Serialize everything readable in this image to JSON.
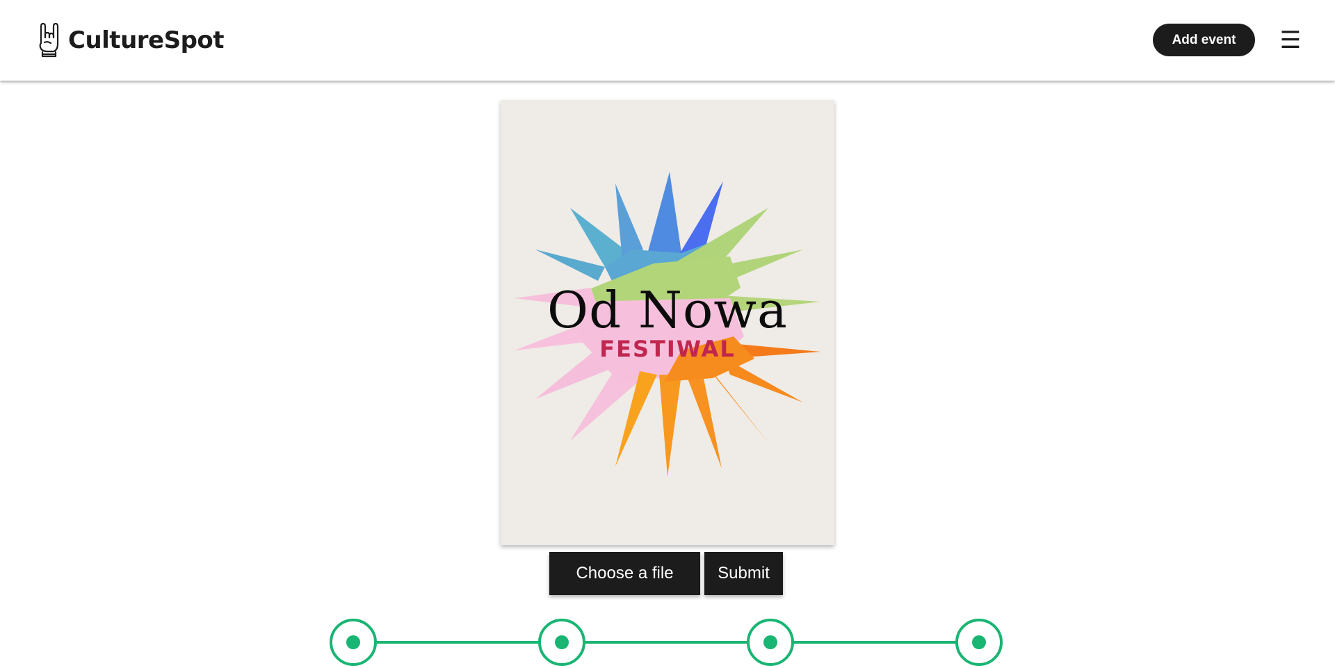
{
  "header": {
    "brand_name": "CultureSpot",
    "logo_icon": "rock-hand-icon",
    "add_event_label": "Add event",
    "menu_icon": "hamburger-menu-icon",
    "menu_glyph": "☰"
  },
  "poster": {
    "title": "Od Nowa",
    "subtitle": "FESTIWAL"
  },
  "upload": {
    "choose_file_label": "Choose a file",
    "submit_label": "Submit"
  },
  "stepper": {
    "total_steps": 4,
    "active_step": 4
  },
  "colors": {
    "accent_green": "#19b573",
    "dark": "#1c1c1c",
    "poster_background": "#efebe6",
    "poster_subtitle": "#c0264f"
  }
}
